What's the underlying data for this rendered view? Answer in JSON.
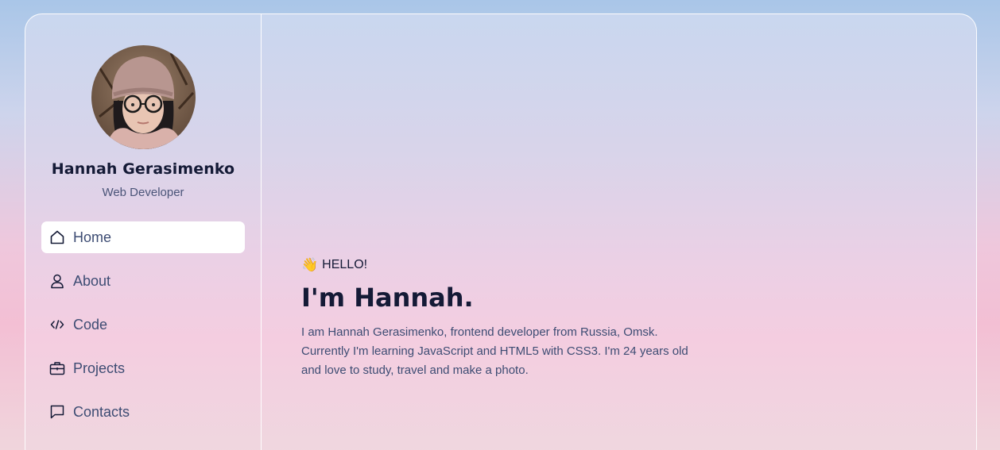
{
  "profile": {
    "name": "Hannah Gerasimenko",
    "role": "Web Developer"
  },
  "nav": {
    "items": [
      {
        "label": "Home",
        "icon": "home-icon",
        "active": true
      },
      {
        "label": "About",
        "icon": "user-icon",
        "active": false
      },
      {
        "label": "Code",
        "icon": "code-icon",
        "active": false
      },
      {
        "label": "Projects",
        "icon": "briefcase-icon",
        "active": false
      },
      {
        "label": "Contacts",
        "icon": "chat-icon",
        "active": false
      }
    ]
  },
  "hero": {
    "greeting": "HELLO!",
    "wave_emoji": "👋",
    "headline": "I'm Hannah.",
    "intro": "I am Hannah Gerasimenko, frontend developer from Russia, Omsk. Currently I'm learning JavaScript and HTML5 with CSS3. I'm 24 years old and love to study, travel and make a photo."
  },
  "colors": {
    "text_dark": "#141a36",
    "text_muted": "#3d4c73",
    "active_bg": "#ffffff"
  }
}
